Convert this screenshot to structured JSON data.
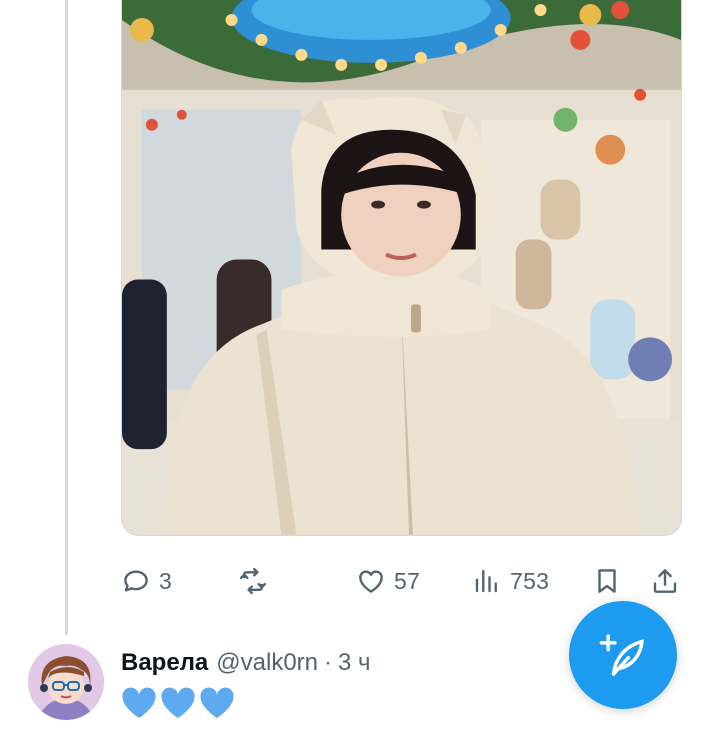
{
  "tweet": {
    "actions": {
      "replies": "3",
      "retweets": "",
      "likes": "57",
      "views": "753"
    }
  },
  "next_tweet": {
    "display_name": "Варела",
    "handle": "@valk0rn",
    "separator": "·",
    "time": "3 ч",
    "body_emoji": [
      "blue-heart",
      "blue-heart",
      "blue-heart"
    ]
  },
  "colors": {
    "accent": "#1d9bf0",
    "secondary_text": "#536471",
    "primary_text": "#0f1419",
    "divider": "#cfd9de",
    "heart_blue": "#5eaaf0"
  },
  "icons": [
    "reply-icon",
    "retweet-icon",
    "like-icon",
    "views-icon",
    "bookmark-icon",
    "share-icon",
    "compose-icon"
  ]
}
